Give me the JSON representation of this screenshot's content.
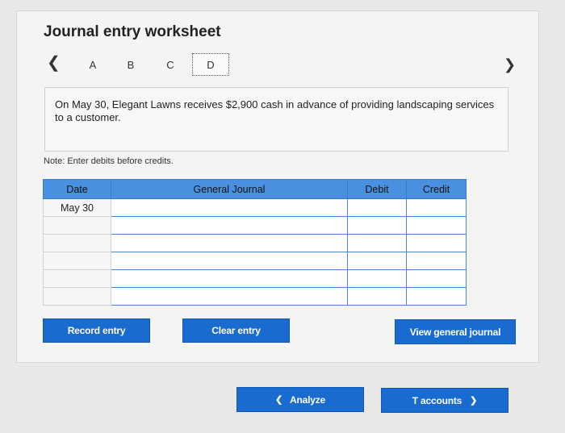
{
  "worksheet": {
    "title": "Journal entry worksheet",
    "tabs": [
      {
        "label": "A"
      },
      {
        "label": "B"
      },
      {
        "label": "C"
      },
      {
        "label": "D"
      }
    ],
    "active_tab": "D",
    "description": "On May 30, Elegant Lawns receives $2,900 cash in advance of providing landscaping services to a customer.",
    "note": "Note: Enter debits before credits."
  },
  "journal_table": {
    "headers": {
      "date": "Date",
      "general_journal": "General Journal",
      "debit": "Debit",
      "credit": "Credit"
    },
    "rows": [
      {
        "date": "May 30",
        "account": "",
        "debit": "",
        "credit": ""
      },
      {
        "date": "",
        "account": "",
        "debit": "",
        "credit": ""
      },
      {
        "date": "",
        "account": "",
        "debit": "",
        "credit": ""
      },
      {
        "date": "",
        "account": "",
        "debit": "",
        "credit": ""
      },
      {
        "date": "",
        "account": "",
        "debit": "",
        "credit": ""
      },
      {
        "date": "",
        "account": "",
        "debit": "",
        "credit": ""
      }
    ]
  },
  "buttons": {
    "record_entry": "Record entry",
    "clear_entry": "Clear entry",
    "view_general_journal": "View general journal",
    "analyze": "Analyze",
    "t_accounts": "T accounts"
  },
  "icons": {
    "prev": "chevron-left-icon",
    "next": "chevron-right-icon"
  }
}
